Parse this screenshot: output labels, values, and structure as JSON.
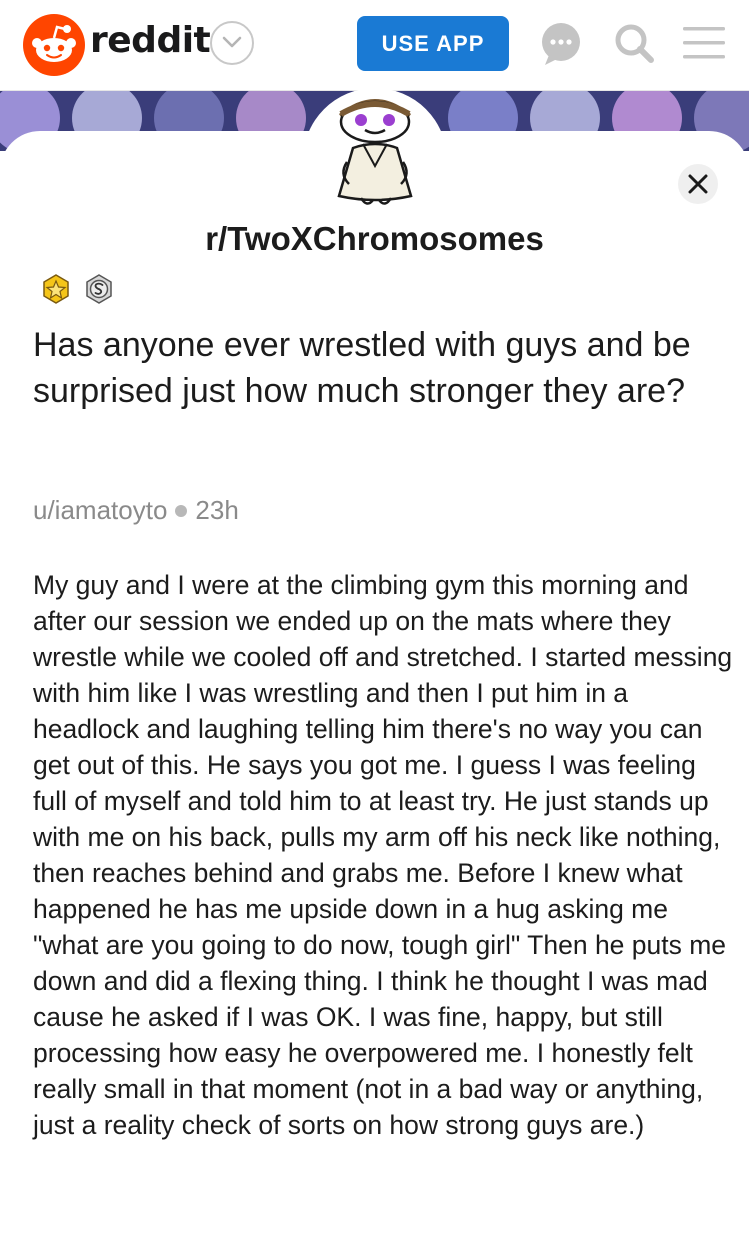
{
  "nav": {
    "brand": "reddit",
    "use_app_label": "USE APP"
  },
  "icons": {
    "logo": "reddit-alien-icon",
    "switcher": "chevron-down-icon",
    "chat": "chat-bubble-icon",
    "search": "search-icon",
    "menu": "hamburger-menu-icon",
    "close": "close-icon",
    "award_1": "gold-star-award-icon",
    "award_2": "silver-award-icon"
  },
  "colors": {
    "brand_orange": "#ff4500",
    "use_app_blue": "#1a7ad4",
    "banner_dark": "#3a3d7a",
    "meta_gray": "#8a8a8a"
  },
  "subreddit": {
    "name": "r/TwoXChromosomes"
  },
  "post": {
    "title": "Has anyone ever wrestled with guys and be surprised just how much stronger they are?",
    "author": "u/iamatoyto",
    "age": "23h",
    "body": "My guy and I were at the climbing gym this morning and after our session we ended up on the mats where they wrestle while we cooled off and stretched. I started messing with him like I was wrestling and then I put him in a headlock and laughing telling him there's no way you can get out of this. He says you got me. I guess I was feeling full of myself and told him to at least try. He just stands up with me on his back, pulls my arm off his neck like nothing, then reaches behind and grabs me. Before I knew what happened he has me upside down in a hug asking me \"what are you going to do now, tough girl\" Then he puts me down and did a flexing thing. I think he thought I was mad cause he asked if I was OK. I was fine, happy, but still processing how easy he overpowered me. I honestly felt really small in that moment (not in a bad way or anything, just a reality check of sorts on how strong guys are.)"
  }
}
